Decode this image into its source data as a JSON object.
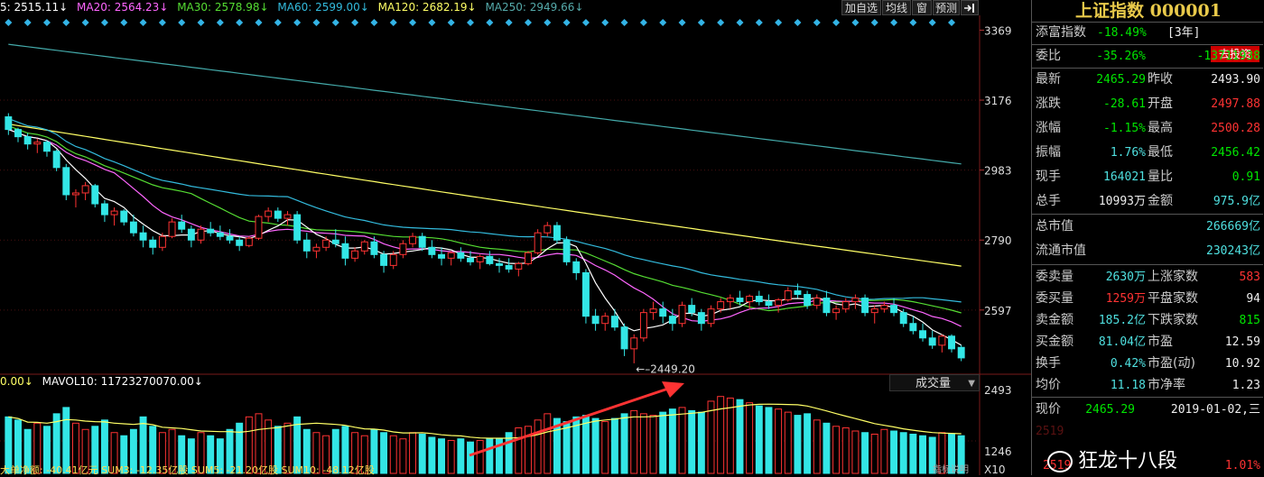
{
  "legend": {
    "ma5": "5: 2515.11↓",
    "ma20": "MA20: 2564.23↓",
    "ma30": "MA30: 2578.98↓",
    "ma60": "MA60: 2599.00↓",
    "ma120": "MA120: 2682.19↓",
    "ma250": "MA250: 2949.66↓"
  },
  "toolbar": {
    "add_watch": "加自选",
    "line_type": "均线",
    "window": "窗",
    "forecast": "预测",
    "exit_icon": "exit-arrow-icon"
  },
  "price_axis": [
    "3369",
    "3176",
    "2983",
    "2790",
    "2597"
  ],
  "low_label": "←–2449.20",
  "volume": {
    "legend_left": "0.00↓",
    "mavol10": "MAVOL10: 11723270070.00↓",
    "dropdown": "成交量",
    "axis": [
      "2493",
      "1246",
      "X10"
    ]
  },
  "bottom_legend": "大单净额: -40.41亿元  SUM3: -12.35亿股  SUM5: -21.20亿股  SUM10: -48.12亿股",
  "bottom_button": "指标说明",
  "panel": {
    "title": "上证指数 000001",
    "tianfu": {
      "label": "添富指数",
      "value": "-18.49%",
      "period": "[3年]",
      "button": "去投资"
    },
    "weibi": {
      "label": "委比",
      "pct": "-35.26%",
      "value": "-13711938"
    },
    "rows1": [
      {
        "l1": "最新",
        "v1": "2465.29",
        "c1": "green",
        "l2": "昨收",
        "v2": "2493.90",
        "c2": "white"
      },
      {
        "l1": "涨跌",
        "v1": "-28.61",
        "c1": "green",
        "l2": "开盘",
        "v2": "2497.88",
        "c2": "red"
      },
      {
        "l1": "涨幅",
        "v1": "-1.15%",
        "c1": "green",
        "l2": "最高",
        "v2": "2500.28",
        "c2": "red"
      },
      {
        "l1": "振幅",
        "v1": "1.76%",
        "c1": "cyan",
        "l2": "最低",
        "v2": "2456.42",
        "c2": "green"
      },
      {
        "l1": "现手",
        "v1": "164021",
        "c1": "cyan",
        "l2": "量比",
        "v2": "0.91",
        "c2": "green"
      },
      {
        "l1": "总手",
        "v1": "10993万",
        "c1": "white",
        "l2": "金额",
        "v2": "975.9亿",
        "c2": "cyan"
      }
    ],
    "zongshizhi": {
      "label": "总市值",
      "value": "266669亿"
    },
    "liutong": {
      "label": "流通市值",
      "value": "230243亿"
    },
    "rows2": [
      {
        "l1": "委卖量",
        "v1": "2630万",
        "c1": "cyan",
        "l2": "上涨家数",
        "v2": "583",
        "c2": "red"
      },
      {
        "l1": "委买量",
        "v1": "1259万",
        "c1": "red",
        "l2": "平盘家数",
        "v2": "94",
        "c2": "white"
      },
      {
        "l1": "卖金额",
        "v1": "185.2亿",
        "c1": "cyan",
        "l2": "下跌家数",
        "v2": "815",
        "c2": "green"
      },
      {
        "l1": "买金额",
        "v1": "81.04亿",
        "c1": "cyan",
        "l2": "市盈",
        "v2": "12.59",
        "c2": "white"
      },
      {
        "l1": "换手",
        "v1": "0.42%",
        "c1": "cyan",
        "l2": "市盈(动)",
        "v2": "10.92",
        "c2": "white"
      },
      {
        "l1": "均价",
        "v1": "11.18",
        "c1": "cyan",
        "l2": "市净率",
        "v2": "1.23",
        "c2": "white"
      }
    ],
    "xianjia": {
      "label": "现价",
      "value": "2465.29",
      "date": "2019-01-02,三"
    },
    "partial_price": "2519",
    "partial_pct": "1.01%"
  },
  "watermark": "狂龙十八段",
  "colors": {
    "up": "#ff3333",
    "down": "#33e6e6",
    "ma5": "#ffffff",
    "ma20": "#ff66ff",
    "ma30": "#55dd33",
    "ma60": "#33bbdd",
    "ma120": "#ffff66",
    "ma250": "#44aaaa",
    "arrow": "#ff3333",
    "volMa": "#ffff66"
  },
  "chart_data": {
    "type": "candlestick",
    "price_range": [
      2420,
      3390
    ],
    "low_marker": 2449.2,
    "candles": [
      [
        3130,
        3140,
        3080,
        3095
      ],
      [
        3095,
        3100,
        3060,
        3075
      ],
      [
        3075,
        3085,
        3040,
        3055
      ],
      [
        3055,
        3070,
        3030,
        3060
      ],
      [
        3060,
        3065,
        3020,
        3035
      ],
      [
        3035,
        3040,
        2980,
        2990
      ],
      [
        2990,
        3000,
        2900,
        2915
      ],
      [
        2915,
        2930,
        2880,
        2920
      ],
      [
        2920,
        2950,
        2900,
        2940
      ],
      [
        2940,
        2945,
        2880,
        2890
      ],
      [
        2890,
        2900,
        2840,
        2860
      ],
      [
        2860,
        2880,
        2830,
        2870
      ],
      [
        2870,
        2875,
        2830,
        2840
      ],
      [
        2840,
        2860,
        2800,
        2810
      ],
      [
        2810,
        2830,
        2770,
        2790
      ],
      [
        2790,
        2800,
        2750,
        2770
      ],
      [
        2770,
        2810,
        2760,
        2800
      ],
      [
        2800,
        2850,
        2795,
        2840
      ],
      [
        2840,
        2860,
        2810,
        2820
      ],
      [
        2820,
        2830,
        2770,
        2790
      ],
      [
        2790,
        2830,
        2780,
        2820
      ],
      [
        2820,
        2840,
        2800,
        2810
      ],
      [
        2810,
        2830,
        2790,
        2800
      ],
      [
        2800,
        2820,
        2780,
        2790
      ],
      [
        2790,
        2800,
        2760,
        2775
      ],
      [
        2775,
        2800,
        2770,
        2795
      ],
      [
        2795,
        2860,
        2790,
        2855
      ],
      [
        2855,
        2880,
        2840,
        2870
      ],
      [
        2870,
        2880,
        2840,
        2850
      ],
      [
        2850,
        2870,
        2830,
        2860
      ],
      [
        2860,
        2870,
        2780,
        2790
      ],
      [
        2790,
        2810,
        2740,
        2760
      ],
      [
        2760,
        2780,
        2740,
        2770
      ],
      [
        2770,
        2800,
        2760,
        2790
      ],
      [
        2790,
        2820,
        2770,
        2780
      ],
      [
        2780,
        2800,
        2720,
        2740
      ],
      [
        2740,
        2770,
        2730,
        2760
      ],
      [
        2760,
        2790,
        2750,
        2785
      ],
      [
        2785,
        2800,
        2740,
        2750
      ],
      [
        2750,
        2760,
        2700,
        2720
      ],
      [
        2720,
        2760,
        2710,
        2750
      ],
      [
        2750,
        2790,
        2740,
        2780
      ],
      [
        2780,
        2810,
        2770,
        2800
      ],
      [
        2800,
        2810,
        2760,
        2770
      ],
      [
        2770,
        2790,
        2740,
        2750
      ],
      [
        2750,
        2770,
        2720,
        2740
      ],
      [
        2740,
        2760,
        2720,
        2755
      ],
      [
        2755,
        2770,
        2730,
        2740
      ],
      [
        2740,
        2760,
        2720,
        2730
      ],
      [
        2730,
        2750,
        2710,
        2745
      ],
      [
        2745,
        2760,
        2720,
        2725
      ],
      [
        2725,
        2740,
        2700,
        2720
      ],
      [
        2720,
        2740,
        2700,
        2710
      ],
      [
        2710,
        2730,
        2690,
        2725
      ],
      [
        2725,
        2760,
        2720,
        2755
      ],
      [
        2755,
        2820,
        2750,
        2810
      ],
      [
        2810,
        2840,
        2800,
        2830
      ],
      [
        2830,
        2840,
        2780,
        2790
      ],
      [
        2790,
        2800,
        2720,
        2730
      ],
      [
        2730,
        2740,
        2680,
        2700
      ],
      [
        2700,
        2710,
        2560,
        2580
      ],
      [
        2580,
        2600,
        2540,
        2560
      ],
      [
        2560,
        2590,
        2540,
        2580
      ],
      [
        2580,
        2600,
        2540,
        2550
      ],
      [
        2550,
        2560,
        2470,
        2490
      ],
      [
        2490,
        2530,
        2450,
        2520
      ],
      [
        2520,
        2600,
        2510,
        2590
      ],
      [
        2590,
        2620,
        2570,
        2600
      ],
      [
        2600,
        2620,
        2560,
        2580
      ],
      [
        2580,
        2600,
        2540,
        2560
      ],
      [
        2560,
        2620,
        2550,
        2610
      ],
      [
        2610,
        2630,
        2580,
        2590
      ],
      [
        2590,
        2600,
        2540,
        2560
      ],
      [
        2560,
        2610,
        2550,
        2600
      ],
      [
        2600,
        2630,
        2590,
        2620
      ],
      [
        2620,
        2640,
        2600,
        2630
      ],
      [
        2630,
        2650,
        2610,
        2620
      ],
      [
        2620,
        2640,
        2600,
        2635
      ],
      [
        2635,
        2650,
        2610,
        2620
      ],
      [
        2620,
        2640,
        2600,
        2610
      ],
      [
        2610,
        2630,
        2590,
        2625
      ],
      [
        2625,
        2660,
        2620,
        2650
      ],
      [
        2650,
        2670,
        2630,
        2640
      ],
      [
        2640,
        2650,
        2600,
        2610
      ],
      [
        2610,
        2640,
        2600,
        2630
      ],
      [
        2630,
        2650,
        2580,
        2590
      ],
      [
        2590,
        2610,
        2570,
        2600
      ],
      [
        2600,
        2630,
        2590,
        2620
      ],
      [
        2620,
        2640,
        2600,
        2630
      ],
      [
        2630,
        2640,
        2580,
        2590
      ],
      [
        2590,
        2610,
        2560,
        2600
      ],
      [
        2600,
        2620,
        2590,
        2610
      ],
      [
        2610,
        2630,
        2580,
        2590
      ],
      [
        2590,
        2600,
        2550,
        2560
      ],
      [
        2560,
        2580,
        2530,
        2540
      ],
      [
        2540,
        2560,
        2510,
        2520
      ],
      [
        2520,
        2540,
        2490,
        2500
      ],
      [
        2500,
        2530,
        2480,
        2525
      ],
      [
        2525,
        2530,
        2480,
        2490
      ],
      [
        2494,
        2500,
        2456,
        2465
      ]
    ],
    "volume_range": [
      0,
      2700
    ],
    "volumes": [
      1800,
      1700,
      1400,
      1600,
      1500,
      1900,
      2100,
      1600,
      1400,
      1500,
      1700,
      1300,
      1200,
      1400,
      1800,
      1500,
      1300,
      1400,
      1200,
      1100,
      1300,
      1200,
      1100,
      1400,
      1600,
      1800,
      1900,
      1700,
      1500,
      1600,
      1800,
      1400,
      1300,
      1200,
      1400,
      1500,
      1300,
      1200,
      1400,
      1300,
      1200,
      1100,
      1300,
      1250,
      1150,
      1100,
      1050,
      1100,
      1000,
      1050,
      1100,
      1100,
      1300,
      1450,
      1500,
      1700,
      1900,
      1750,
      1650,
      1800,
      1850,
      1750,
      1650,
      1750,
      1900,
      2000,
      1900,
      1850,
      1950,
      2050,
      2100,
      2000,
      1950,
      2300,
      2450,
      2400,
      2350,
      2250,
      2150,
      2100,
      2050,
      1950,
      1850,
      1900,
      1700,
      1600,
      1500,
      1450,
      1350,
      1300,
      1250,
      1400,
      1350,
      1300,
      1250,
      1200,
      1150,
      1300,
      1250,
      1200
    ]
  }
}
